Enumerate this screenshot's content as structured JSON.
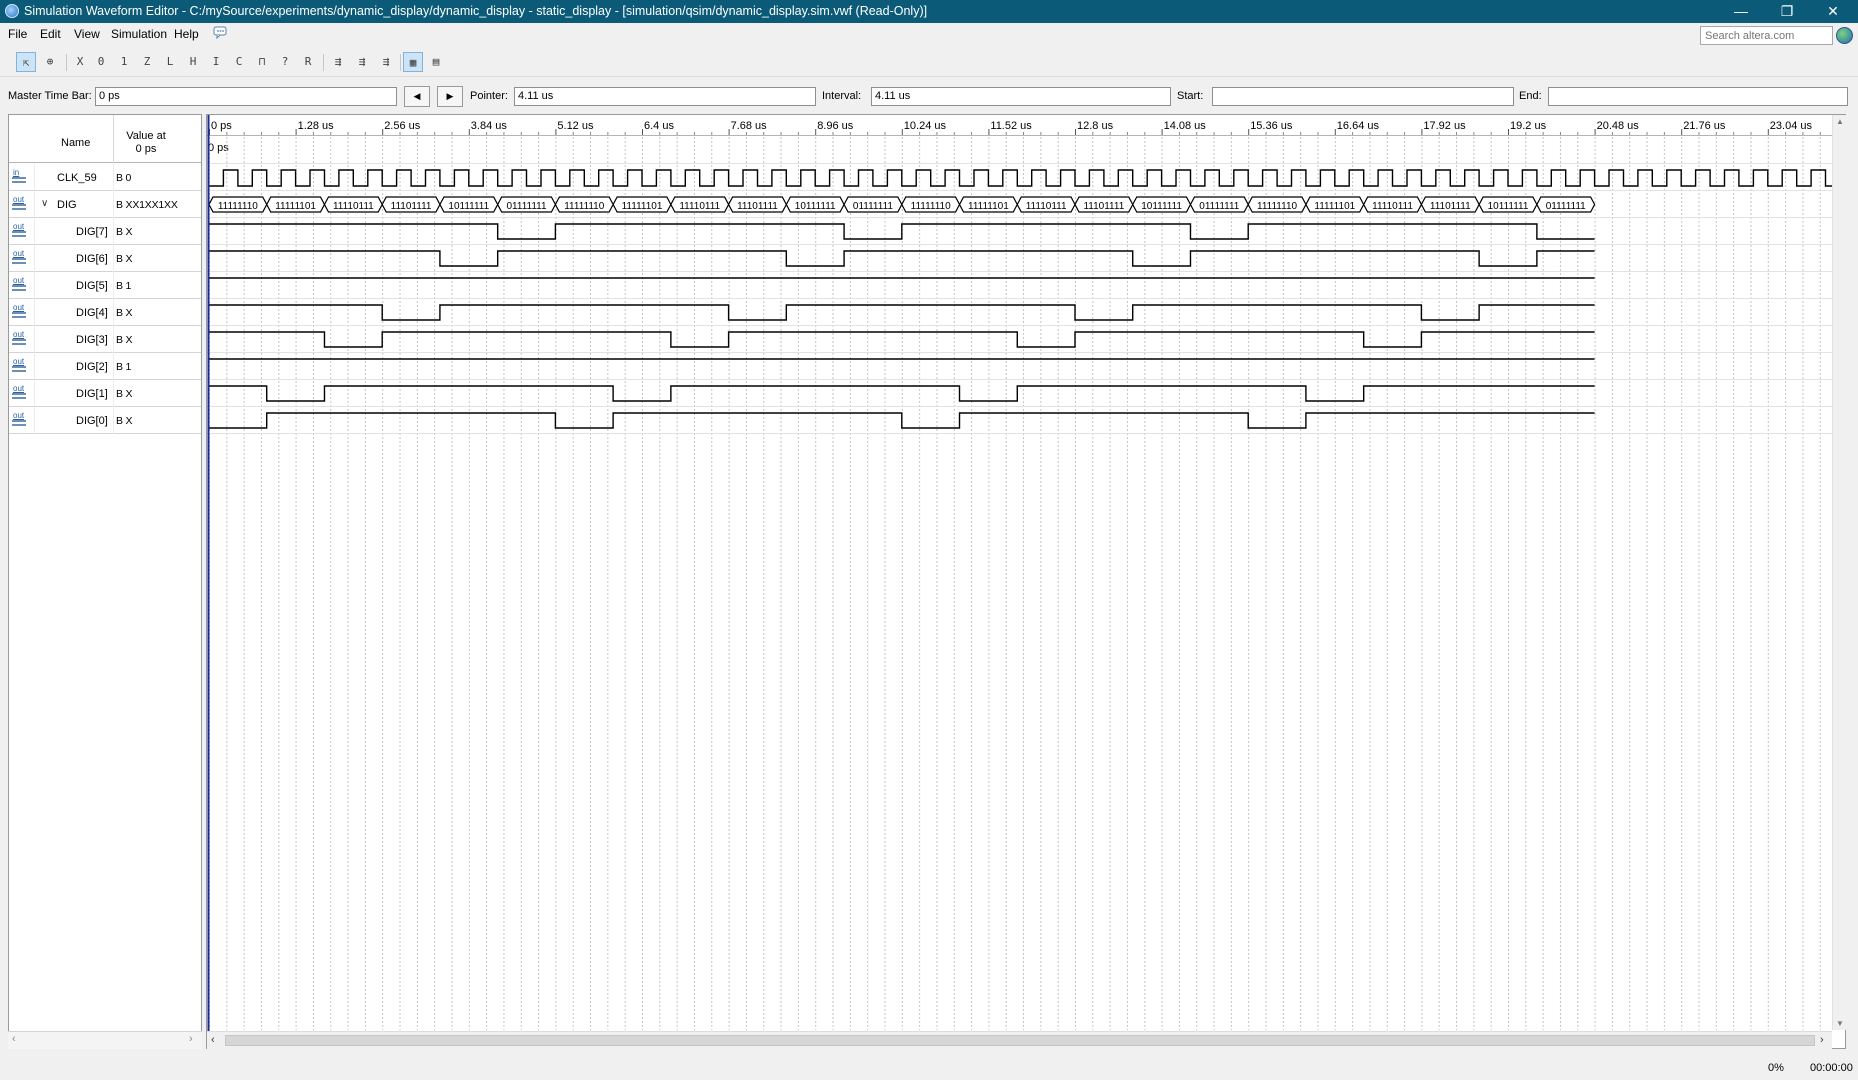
{
  "window": {
    "title": "Simulation Waveform Editor - C:/mySource/experiments/dynamic_display/dynamic_display - static_display - [simulation/qsim/dynamic_display.sim.vwf (Read-Only)]",
    "minimize_glyph": "—",
    "restore_glyph": "❐",
    "close_glyph": "✕"
  },
  "menu": {
    "items": [
      "File",
      "Edit",
      "View",
      "Simulation",
      "Help"
    ],
    "search_placeholder": "Search altera.com"
  },
  "toolbar": {
    "icons": [
      "selection-tool-icon",
      "zoom-tool-icon",
      "force-unknown-icon",
      "force-low-icon",
      "force-high-icon",
      "force-high-impedance-icon",
      "force-weak-low-icon",
      "force-weak-high-icon",
      "invert-icon",
      "count-value-icon",
      "overwrite-clock-icon",
      "random-values-icon",
      "dont-care-icon",
      "arbitrary-value-icon",
      "run-functional-simulation-icon",
      "run-timing-simulation-icon",
      "generate-netlist-icon",
      "snap-to-grid-icon",
      "grid-settings-icon"
    ]
  },
  "timebar": {
    "master_label": "Master Time Bar:",
    "master_value": "0 ps",
    "prev_glyph": "◀",
    "next_glyph": "▶",
    "pointer_label": "Pointer:",
    "pointer_value": "4.11 us",
    "interval_label": "Interval:",
    "interval_value": "4.11 us",
    "start_label": "Start:",
    "start_value": "",
    "end_label": "End:",
    "end_value": ""
  },
  "columns": {
    "name": "Name",
    "value_at_line1": "Value at",
    "value_at_line2": "0 ps"
  },
  "signals": [
    {
      "kind": "in",
      "name": "CLK_59",
      "value": "B 0"
    },
    {
      "kind": "out",
      "name": "DIG",
      "value": "B XX1XX1XX",
      "group": true
    },
    {
      "kind": "out",
      "name": "DIG[7]",
      "value": "B X"
    },
    {
      "kind": "out",
      "name": "DIG[6]",
      "value": "B X"
    },
    {
      "kind": "out",
      "name": "DIG[5]",
      "value": "B 1"
    },
    {
      "kind": "out",
      "name": "DIG[4]",
      "value": "B X"
    },
    {
      "kind": "out",
      "name": "DIG[3]",
      "value": "B X"
    },
    {
      "kind": "out",
      "name": "DIG[2]",
      "value": "B 1"
    },
    {
      "kind": "out",
      "name": "DIG[1]",
      "value": "B X"
    },
    {
      "kind": "out",
      "name": "DIG[0]",
      "value": "B X"
    }
  ],
  "waveform": {
    "time_ticks": [
      "0 ps",
      "1.28 us",
      "2.56 us",
      "3.84 us",
      "5.12 us",
      "6.4 us",
      "7.68 us",
      "8.96 us",
      "10.24 us",
      "11.52 us",
      "12.8 us",
      "14.08 us",
      "15.36 us",
      "16.64 us",
      "17.92 us",
      "19.2 us",
      "20.48 us",
      "21.76 us",
      "23.04 us"
    ],
    "master_marker_label": "0 ps",
    "bus_values": [
      "11111110",
      "11111101",
      "11110111",
      "11101111",
      "10111111",
      "01111111",
      "11111110",
      "11111101",
      "11110111",
      "11101111",
      "10111111",
      "01111111",
      "11111110",
      "11111101",
      "11110111",
      "11101111",
      "10111111",
      "01111111",
      "11111110",
      "11111101",
      "11110111",
      "11101111",
      "10111111",
      "01111111"
    ]
  },
  "colors": {
    "titlebar": "#0a5a78",
    "wave": "#000000",
    "cursor": "#1b2a9a",
    "grid": "#c4c4c4"
  },
  "status": {
    "progress": "0%",
    "elapsed": "00:00:00"
  }
}
